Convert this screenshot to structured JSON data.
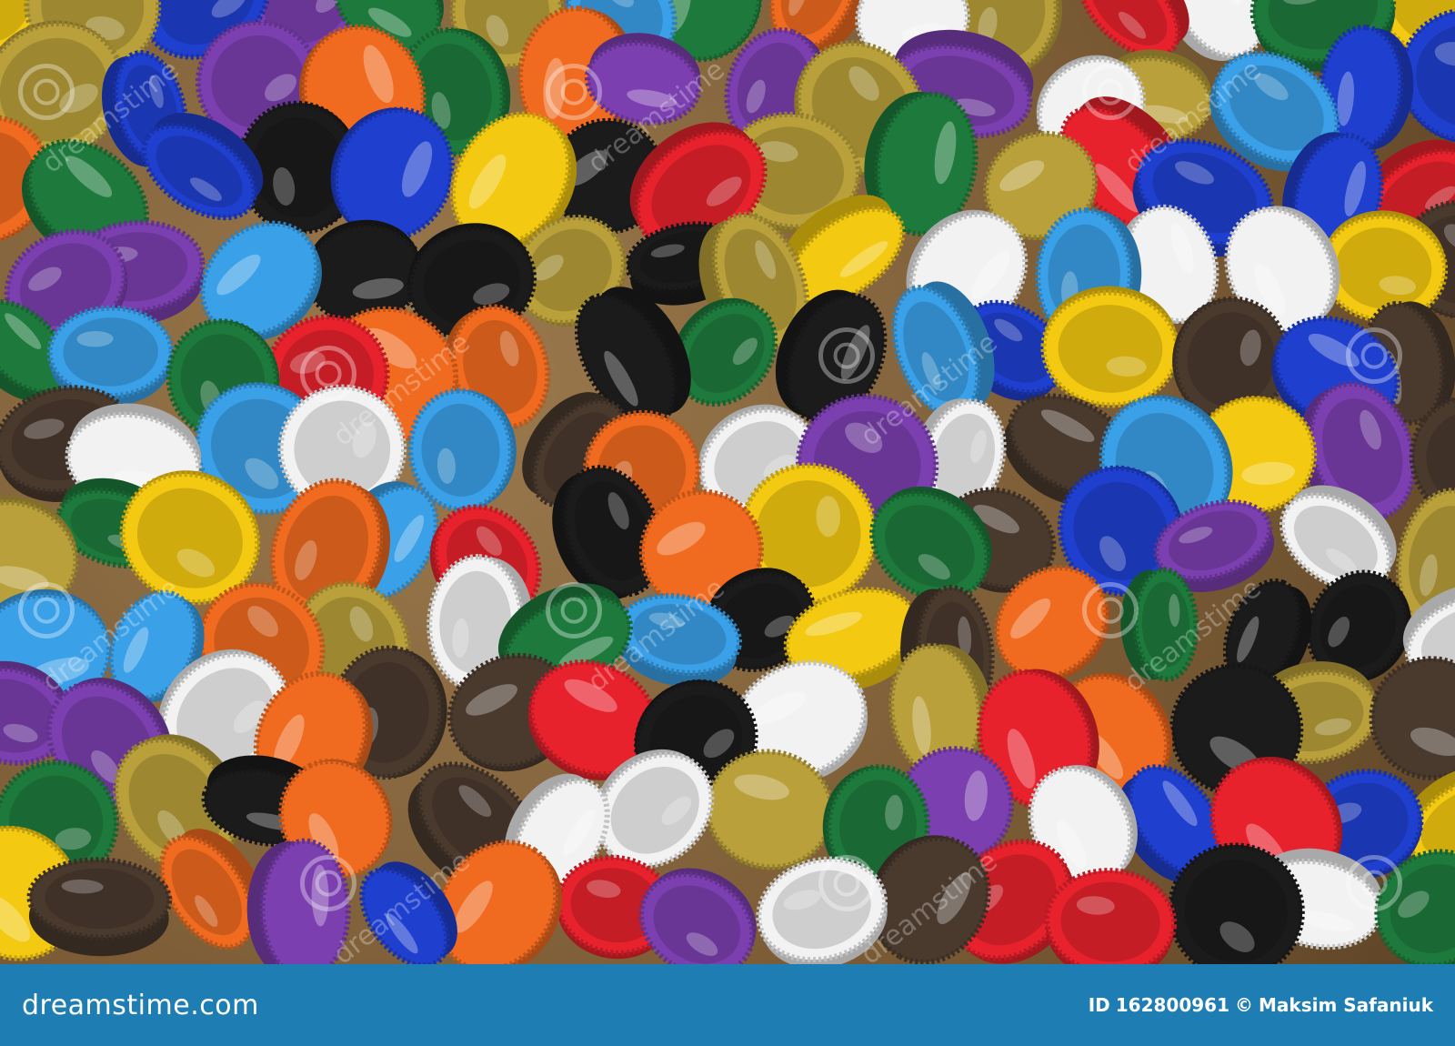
{
  "photo": {
    "subject": "bottle-caps",
    "background_color": "#7a5b35",
    "cap_colors": [
      "#e8222d",
      "#1f3fcf",
      "#f4c911",
      "#1e7a3c",
      "#1b1b1b",
      "#f2f2f2",
      "#3aa0e8",
      "#f06a1f",
      "#b9a03a",
      "#4a3a2e",
      "#7b3fb0"
    ],
    "watermark_text": "dreamstime"
  },
  "footer": {
    "logo_text": "dreamstime.com",
    "id_label": "ID",
    "id_value": "162800961",
    "copyright_symbol": "©",
    "author": "Maksim Safaniuk",
    "bar_color": "#1e7eb4"
  }
}
